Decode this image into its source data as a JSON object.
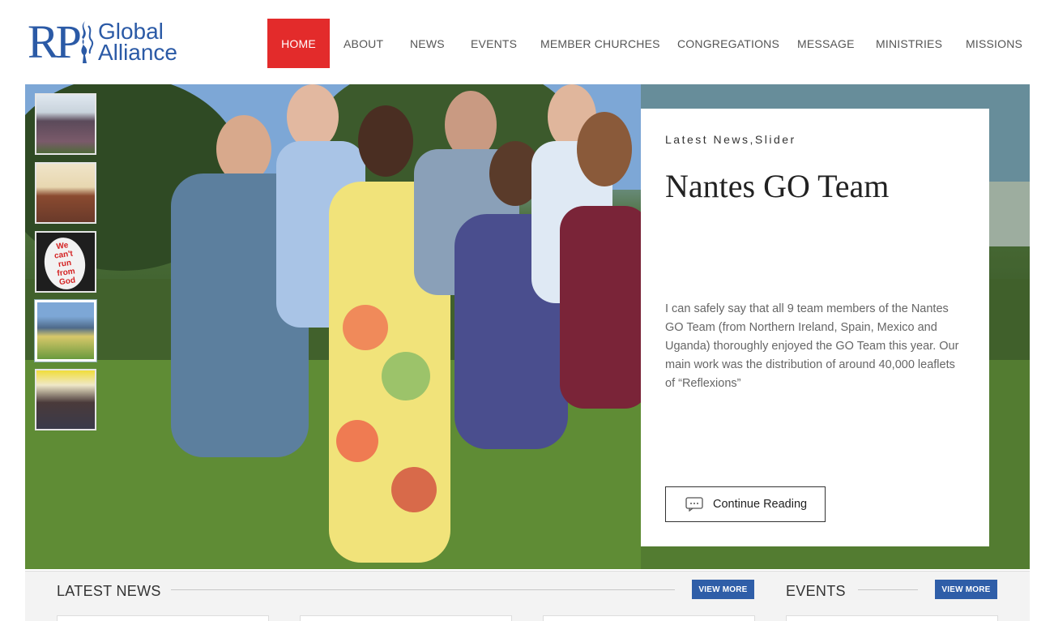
{
  "logo": {
    "initials": "RP",
    "line1": "Global",
    "line2": "Alliance",
    "color": "#2b5aa6"
  },
  "nav": {
    "items": [
      {
        "label": "HOME",
        "active": true
      },
      {
        "label": "ABOUT"
      },
      {
        "label": "NEWS"
      },
      {
        "label": "EVENTS"
      },
      {
        "label": "MEMBER CHURCHES"
      },
      {
        "label": "CONGREGATIONS"
      },
      {
        "label": "MESSAGE"
      },
      {
        "label": "MINISTRIES"
      },
      {
        "label": "MISSIONS"
      }
    ],
    "active_color": "#e32b2b"
  },
  "slider": {
    "thumbnails": [
      {
        "name": "group-photo-outdoors"
      },
      {
        "name": "church-congregation"
      },
      {
        "name": "quote-poster",
        "text": "We can't run from God"
      },
      {
        "name": "nantes-go-team",
        "active": true
      },
      {
        "name": "youth-group"
      }
    ],
    "card": {
      "category": "Latest News,Slider",
      "title": "Nantes GO Team",
      "excerpt": "I can safely say that all 9 team members of the Nantes GO Team (from Northern Ireland, Spain, Mexico and Uganda) thoroughly enjoyed the GO Team this year. Our main work was the distribution of around 40,000 leaflets of “Reflexions”",
      "button": "Continue Reading"
    }
  },
  "sections": {
    "latest_news": {
      "title": "LATEST NEWS",
      "button": "VIEW MORE"
    },
    "events": {
      "title": "EVENTS",
      "button": "VIEW MORE"
    },
    "button_color": "#2f5ea8"
  }
}
